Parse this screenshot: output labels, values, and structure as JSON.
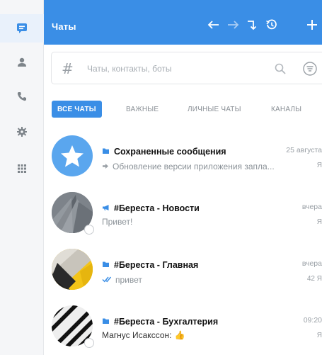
{
  "app": {
    "header_title": "Чаты",
    "icons": {
      "back": "arrow-left-icon",
      "forward": "arrow-right-icon",
      "jump": "jump-arrow-icon",
      "history": "history-icon",
      "add": "plus-icon"
    },
    "accent_color": "#3a8ee6"
  },
  "sidebar": {
    "items": [
      {
        "icon": "chat-icon",
        "active": true
      },
      {
        "icon": "person-icon",
        "active": false
      },
      {
        "icon": "phone-icon",
        "active": false
      },
      {
        "icon": "gear-icon",
        "active": false
      },
      {
        "icon": "apps-grid-icon",
        "active": false
      }
    ]
  },
  "search": {
    "hash_symbol": "#",
    "placeholder": "Чаты, контакты, боты",
    "value": ""
  },
  "tabs": [
    {
      "label": "ВСЕ ЧАТЫ",
      "active": true
    },
    {
      "label": "ВАЖНЫЕ",
      "active": false
    },
    {
      "label": "ЛИЧНЫЕ ЧАТЫ",
      "active": false
    },
    {
      "label": "КАНАЛЫ",
      "active": false
    }
  ],
  "chats": [
    {
      "title": "Сохраненные сообщения",
      "time": "25 августа",
      "preview": "Обновление версии приложения запла...",
      "side": "Я",
      "type_icon": "folder-icon",
      "preview_icon": "forward-arrow-icon",
      "avatar": "star-avatar"
    },
    {
      "title": "#Береста - Новости",
      "time": "вчера",
      "preview": "Привет!",
      "side": "Я",
      "type_icon": "megaphone-icon",
      "avatar": "photo-avatar-gray"
    },
    {
      "title": "#Береста - Главная",
      "time": "вчера",
      "preview": "привет",
      "side": "42 Я",
      "type_icon": "folder-icon",
      "preview_icon": "double-check-icon",
      "avatar": "photo-avatar-yellow"
    },
    {
      "title": "#Береста - Бухгалтерия",
      "time": "09:20",
      "preview": "Магнус Исакссон:",
      "preview_emoji": "👍",
      "side": "Я",
      "type_icon": "folder-icon",
      "avatar": "photo-avatar-stripes"
    }
  ]
}
